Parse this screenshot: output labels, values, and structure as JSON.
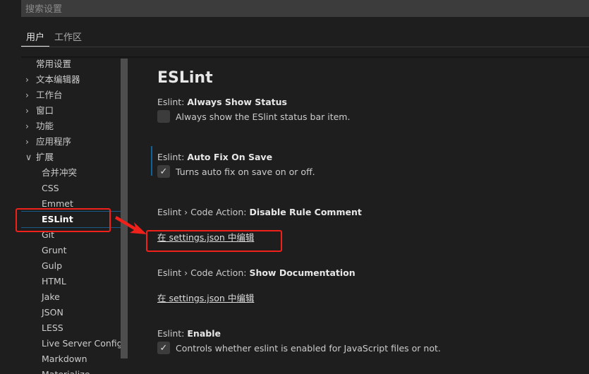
{
  "search": {
    "placeholder": "搜索设置"
  },
  "tabs": [
    "用户",
    "工作区"
  ],
  "tree": [
    {
      "label": "常用设置",
      "level": 0,
      "chev": false
    },
    {
      "label": "文本编辑器",
      "level": 0,
      "chev": true
    },
    {
      "label": "工作台",
      "level": 0,
      "chev": true
    },
    {
      "label": "窗口",
      "level": 0,
      "chev": true
    },
    {
      "label": "功能",
      "level": 0,
      "chev": true
    },
    {
      "label": "应用程序",
      "level": 0,
      "chev": true
    },
    {
      "label": "扩展",
      "level": 0,
      "chev": true,
      "open": true
    },
    {
      "label": "合并冲突",
      "level": 1
    },
    {
      "label": "CSS",
      "level": 1
    },
    {
      "label": "Emmet",
      "level": 1
    },
    {
      "label": "ESLint",
      "level": 1,
      "selected": true
    },
    {
      "label": "Git",
      "level": 1
    },
    {
      "label": "Grunt",
      "level": 1
    },
    {
      "label": "Gulp",
      "level": 1
    },
    {
      "label": "HTML",
      "level": 1
    },
    {
      "label": "Jake",
      "level": 1
    },
    {
      "label": "JSON",
      "level": 1
    },
    {
      "label": "LESS",
      "level": 1
    },
    {
      "label": "Live Server Config",
      "level": 1
    },
    {
      "label": "Markdown",
      "level": 1
    },
    {
      "label": "Materialize",
      "level": 1
    }
  ],
  "main": {
    "title": "ESLint",
    "settings": [
      {
        "prefix": "Eslint: ",
        "name": "Always Show Status",
        "desc": "Always show the ESlint status bar item.",
        "checked": false
      },
      {
        "prefix": "Eslint: ",
        "name": "Auto Fix On Save",
        "desc": "Turns auto fix on save on or off.",
        "checked": true
      },
      {
        "prefix": "Eslint › Code Action: ",
        "name": "Disable Rule Comment",
        "link": "在 settings.json 中编辑"
      },
      {
        "prefix": "Eslint › Code Action: ",
        "name": "Show Documentation",
        "link": "在 settings.json 中编辑"
      },
      {
        "prefix": "Eslint: ",
        "name": "Enable",
        "desc": "Controls whether eslint is enabled for JavaScript files or not.",
        "checked": true
      }
    ]
  },
  "annotation_color": "#f0201a"
}
